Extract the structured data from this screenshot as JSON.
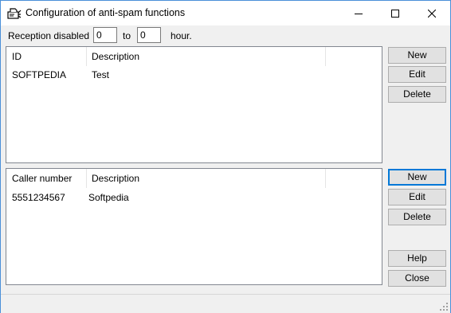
{
  "window": {
    "title": "Configuration of anti-spam functions",
    "icon": "fax-icon",
    "controls": {
      "minimize": "minimize-icon",
      "maximize": "maximize-icon",
      "close": "close-icon"
    }
  },
  "reception": {
    "label": "Reception disabled",
    "from_value": "0",
    "to_label": "to",
    "to_value": "0",
    "unit": "hour."
  },
  "id_list": {
    "columns": [
      "ID",
      "Description"
    ],
    "rows": [
      {
        "id": "SOFTPEDIA",
        "description": "Test"
      }
    ]
  },
  "caller_list": {
    "columns": [
      "Caller number",
      "Description"
    ],
    "rows": [
      {
        "number": "5551234567",
        "description": "Softpedia"
      }
    ]
  },
  "buttons_top": {
    "new": "New",
    "edit": "Edit",
    "delete": "Delete"
  },
  "buttons_bottom": {
    "new": "New",
    "edit": "Edit",
    "delete": "Delete",
    "help": "Help",
    "close": "Close"
  }
}
